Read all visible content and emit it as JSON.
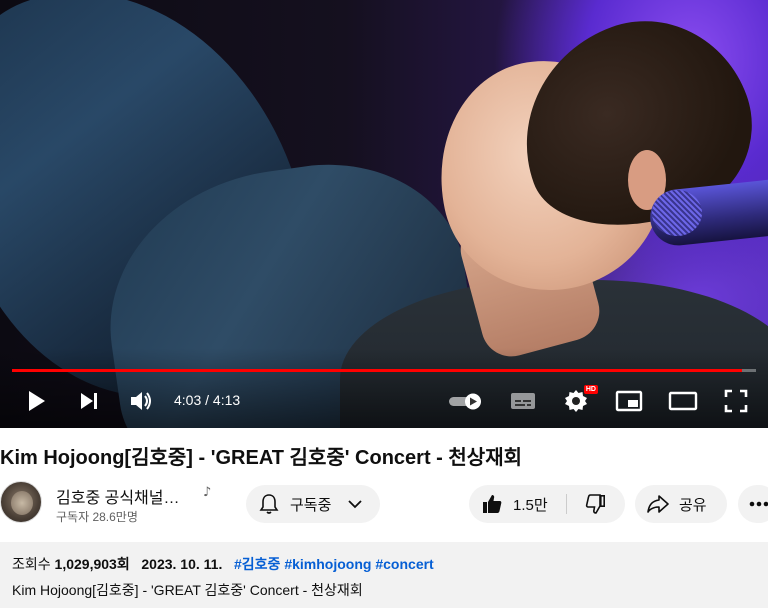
{
  "player": {
    "time_current": "4:03",
    "time_total": "4:13",
    "time_separator": " / ",
    "progress": 0.981,
    "hd_badge": "HD",
    "icons": [
      "play-icon",
      "next-icon",
      "volume-icon",
      "autoplay-toggle-icon",
      "subtitles-icon",
      "settings-icon",
      "miniplayer-icon",
      "theater-icon",
      "fullscreen-icon"
    ],
    "accent_color": "#ff0000"
  },
  "video": {
    "title": "Kim Hojoong[김호중] - 'GREAT 김호중' Concert - 천상재회"
  },
  "channel": {
    "name": "김호중 공식채널…",
    "subscribers": "구독자 28.6만명"
  },
  "actions": {
    "subscribe_label": "구독중",
    "like_count": "1.5만",
    "share_label": "공유"
  },
  "description": {
    "views_label": "조회수",
    "views_value": "1,029,903회",
    "date": "2023. 10. 11.",
    "tags": [
      "#김호중",
      "#kimhojoong",
      "#concert"
    ],
    "text": "Kim Hojoong[김호중] - 'GREAT 김호중' Concert - 천상재회",
    "tag_color": "#065fd4"
  }
}
